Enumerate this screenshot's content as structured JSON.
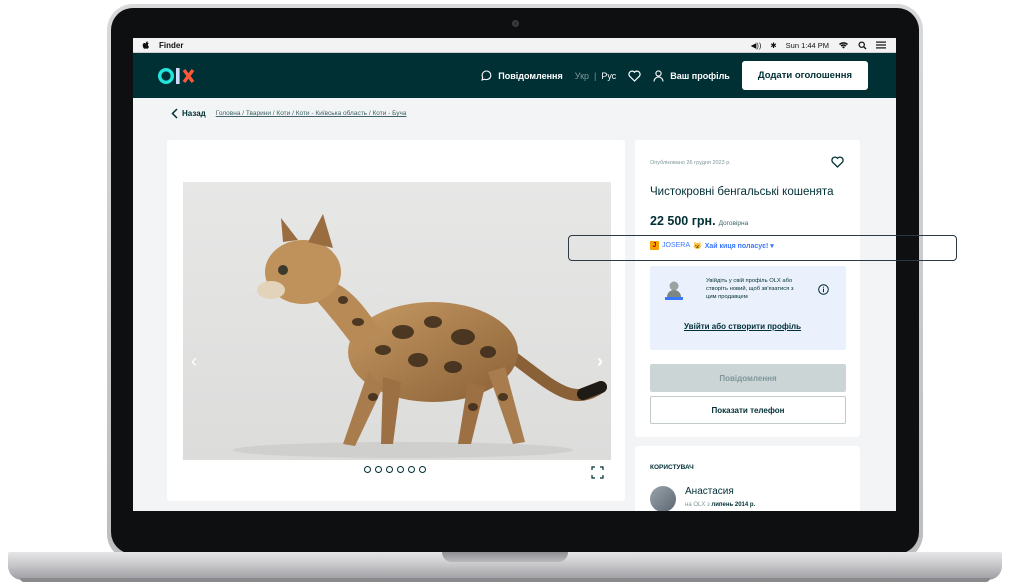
{
  "menubar": {
    "app_name": "Finder",
    "clock": "Sun 1:44 PM"
  },
  "header": {
    "messages_label": "Повідомлення",
    "lang_ukr": "Укр",
    "lang_sep": "|",
    "lang_rus": "Рус",
    "profile_label": "Ваш профіль",
    "add_button": "Додати оголошення"
  },
  "breadcrumb": {
    "back_label": "Назад",
    "path": "Головна / Тварини / Коти / Коти - Київська область / Коти - Буча"
  },
  "gallery": {
    "photo_count": 6,
    "active_index": 0
  },
  "listing": {
    "published": "Опубліковано 26 грудня 2023 р.",
    "title": "Чистокровні бенгальські кошенята",
    "price": "22 500 грн.",
    "price_note": "Договірна",
    "promo_brand": "JOSERA",
    "promo_text": "Хай киця поласує! ▾"
  },
  "login_prompt": {
    "text": "Увійдіть у свій профіль OLX або створіть новий, щоб зв'язатися з цим продавцем",
    "link": "Увійти або створити профіль"
  },
  "actions": {
    "message_button": "Повідомлення",
    "phone_button": "Показати телефон"
  },
  "user": {
    "heading": "КОРИСТУВАЧ",
    "name": "Анастасия",
    "since_prefix": "на OLX з",
    "since_date": "липень 2014 р."
  },
  "colors": {
    "brand_dark": "#002f34",
    "accent_link": "#3a77ff",
    "login_bg": "#eaf1fd"
  }
}
